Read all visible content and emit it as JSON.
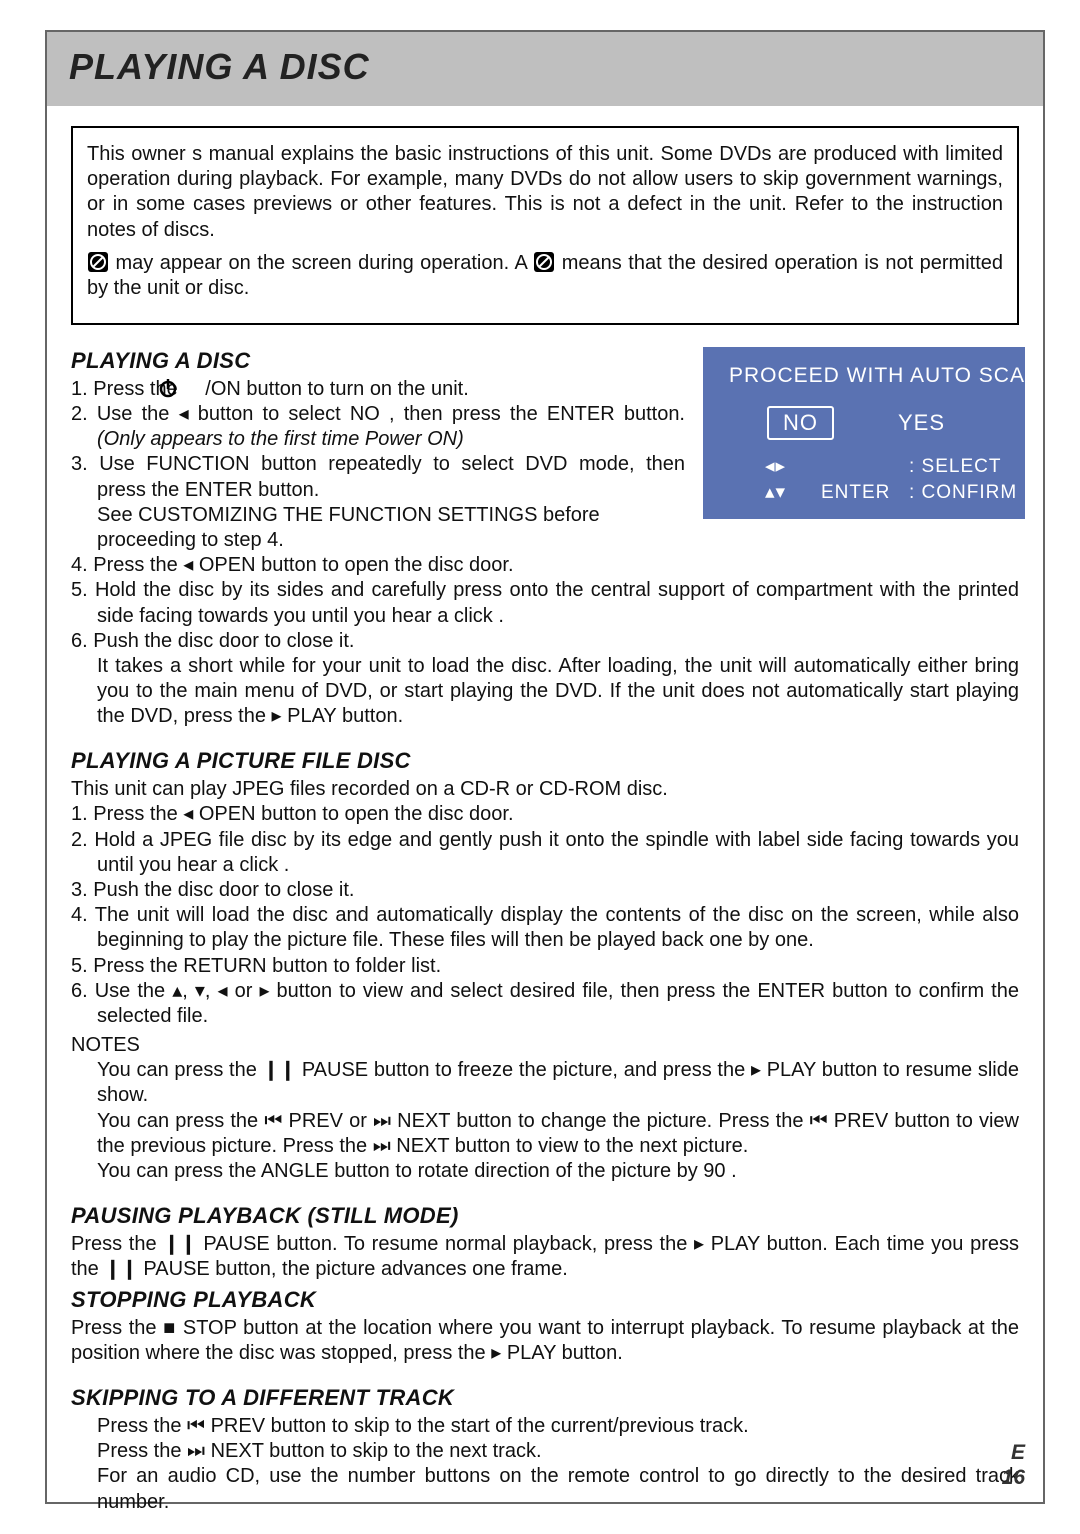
{
  "header": {
    "title": "PLAYING A DISC"
  },
  "intro": {
    "p1": "This owner s manual explains the basic instructions of this unit. Some DVDs are produced with limited operation during playback. For example, many DVDs do not allow users to skip government warnings, or in some cases previews or other features. This is not a defect in the unit. Refer to the instruction notes of discs.",
    "p2a": " may appear on the screen during operation. A ",
    "p2b": " means that the desired operation is not permitted by the unit or disc."
  },
  "osd": {
    "title": "PROCEED WITH AUTO SCA",
    "no": "NO",
    "yes": "YES",
    "hint_select_sym": "◂▸",
    "hint_select": ": SELECT",
    "hint_confirm_sym": "▴▾",
    "hint_confirm_k": "ENTER",
    "hint_confirm": ": CONFIRM"
  },
  "sec1": {
    "title": "PLAYING A DISC",
    "s1a": "1. Press the ",
    "s1b": "/ON button to turn on the unit.",
    "s2a": "2. Use the ◂ button to select  NO , then press the  ENTER button. ",
    "s2b": "(Only appears to the first time Power ON)",
    "s3": "3. Use FUNCTION button repeatedly to select DVD mode, then press the ENTER button.",
    "s3note": "See CUSTOMIZING THE FUNCTION SETTINGS before proceeding to step 4.",
    "s4": "4. Press the ◂ OPEN button to open the disc door.",
    "s5": "5. Hold the disc by its sides and carefully press onto the central support of compartment with the printed side facing towards you until you hear a  click .",
    "s6": "6. Push the disc door to close it.",
    "s6b": "It takes a short while for your unit to load the disc. After loading, the unit will automatically either bring you to the main menu of DVD, or start playing the DVD. If the unit does not automatically start playing the DVD, press the ▸ PLAY  button."
  },
  "sec2": {
    "title": "PLAYING A PICTURE FILE DISC",
    "lead": "This unit can play JPEG files recorded on a CD-R or CD-ROM disc.",
    "s1": "1. Press the ◂ OPEN button to open the disc door.",
    "s2": "2. Hold a JPEG file disc by its edge and gently push it onto the spindle with label side facing towards you until you hear a  click .",
    "s3": "3. Push the disc door to close it.",
    "s4": "4. The unit will load the disc and automatically display the contents of the disc on the screen, while also beginning to play the picture file. These files will then be played back one by one.",
    "s5": "5. Press the RETURN button to folder list.",
    "s6": "6. Use the ▴, ▾, ◂ or ▸ button to view and select desired file, then press the ENTER button to confirm the selected file.",
    "notes_label": "NOTES",
    "n1": "You can press the ❙❙ PAUSE  button to freeze the picture, and press the ▸ PLAY button to resume slide show.",
    "n2": "You can press the  ⏮ PREV or ⏭ NEXT button to change the picture. Press the ⏮ PREV button to view the previous picture. Press the  ⏭ NEXT button to view to the next picture.",
    "n3": "You can press the  ANGLE  button to rotate direction of the picture by 90 ."
  },
  "sec3": {
    "title": "PAUSING PLAYBACK (STILL MODE)",
    "body": "Press the ❙❙ PAUSE button. To resume normal playback, press the ▸ PLAY  button. Each time you press the ❙❙ PAUSE button, the picture advances one frame."
  },
  "sec4": {
    "title": "STOPPING PLAYBACK",
    "body": "Press the ■ STOP button at the location where you want to interrupt playback. To resume playback at the position where the disc was stopped, press the ▸ PLAY  button."
  },
  "sec5": {
    "title": "SKIPPING TO A DIFFERENT TRACK",
    "b1": "Press the ⏮ PREV button to skip to the start of the current/previous track.",
    "b2": "Press the  ⏭ NEXT button to skip to the next track.",
    "b3": "For an audio CD, use the number buttons on the remote control to go directly to the desired track number."
  },
  "footer": {
    "lang": "E",
    "page": "16"
  }
}
